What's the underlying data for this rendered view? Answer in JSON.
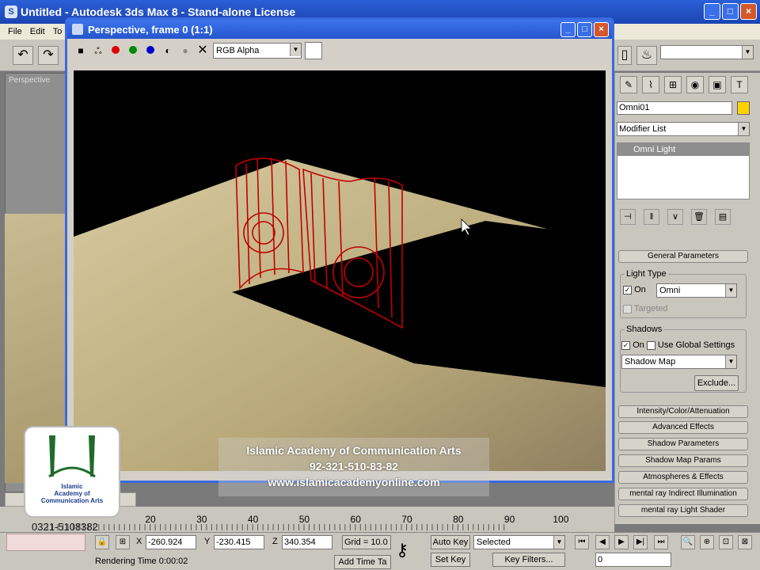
{
  "main_window": {
    "title": "Untitled - Autodesk 3ds Max 8 - Stand-alone License",
    "menu": [
      "File",
      "Edit",
      "To"
    ]
  },
  "viewport": {
    "label": "Perspective"
  },
  "render_window": {
    "title": "Perspective, frame 0 (1:1)",
    "channel": "RGB Alpha"
  },
  "command_panel": {
    "object_name": "Omni01",
    "object_color": "#ffd200",
    "modifier_list": "Modifier List",
    "stack_item": "Omni Light",
    "rollouts": {
      "general": "General Parameters",
      "light_type_label": "Light Type",
      "on_label": "On",
      "light_type_value": "Omni",
      "targeted_label": "Targeted",
      "shadows_label": "Shadows",
      "shadows_on_label": "On",
      "use_global_label": "Use Global Settings",
      "shadow_type": "Shadow Map",
      "exclude_button": "Exclude...",
      "collapsed": [
        "Intensity/Color/Attenuation",
        "Advanced Effects",
        "Shadow Parameters",
        "Shadow Map Params",
        "Atmospheres & Effects",
        "mental ray Indirect Illumination",
        "mental ray Light Shader"
      ]
    }
  },
  "timeline": {
    "ticks": [
      "20",
      "30",
      "40",
      "50",
      "60",
      "70",
      "80",
      "90",
      "100"
    ]
  },
  "status": {
    "x_label": "X",
    "x_value": "-260.924",
    "y_label": "Y",
    "y_value": "-230.415",
    "z_label": "Z",
    "z_value": "340.354",
    "grid": "Grid = 10.0",
    "rendering_time": "Rendering Time  0:00:02",
    "add_time_tag": "Add Time Ta",
    "auto_key": "Auto Key",
    "set_key": "Set Key",
    "selected": "Selected",
    "key_filters": "Key Filters...",
    "frame": "0"
  },
  "watermark": {
    "line1": "Islamic Academy of Communication Arts",
    "line2": "92-321-510-83-82",
    "line3": "www.islamicacademyonline.com",
    "logo_text_1": "Islamic",
    "logo_text_2": "Academy of",
    "logo_text_3": "Communication Arts",
    "phone": "0321-5108382"
  }
}
